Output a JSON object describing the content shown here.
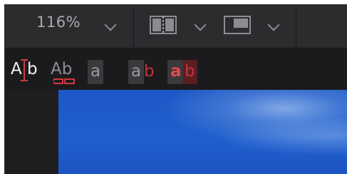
{
  "toolbar": {
    "zoom_value": "116%",
    "zoom_dropdown_icon": "chevron-down-icon",
    "split_view_icon": "split-view-icon",
    "split_view_dropdown_icon": "chevron-down-icon",
    "single_view_icon": "single-view-icon",
    "single_view_dropdown_icon": "chevron-down-icon"
  },
  "text_tools": {
    "cursor_tool": {
      "a": "A",
      "b": "b",
      "icon": "text-cursor-icon"
    },
    "underline_tool": {
      "text": "Ab",
      "icon": "underline-marker-icon"
    },
    "highlight_a": "a",
    "ab_pair_a": "a",
    "ab_pair_b": "b",
    "ab_red_a": "a",
    "ab_red_b": "b"
  },
  "colors": {
    "toolbar_bg": "#2c2c2f",
    "row_bg": "#1b1b1d",
    "accent_red": "#d23a3f",
    "canvas_blue": "#1f5fcd"
  }
}
